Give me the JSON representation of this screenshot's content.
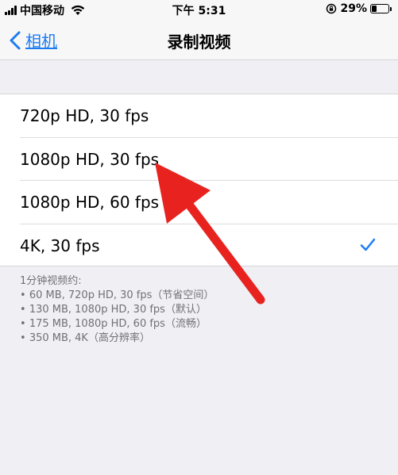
{
  "status_bar": {
    "carrier": "中国移动",
    "time": "下午 5:31",
    "battery_percent": "29%",
    "battery_level": 0.29
  },
  "nav": {
    "back_label": "相机",
    "title": "录制视频"
  },
  "options": [
    {
      "label": "720p HD, 30 fps",
      "selected": false
    },
    {
      "label": "1080p HD, 30 fps",
      "selected": false
    },
    {
      "label": "1080p HD, 60 fps",
      "selected": false
    },
    {
      "label": "4K, 30 fps",
      "selected": true
    }
  ],
  "footer": {
    "heading": "1分钟视频约:",
    "items": [
      "60 MB, 720p HD, 30 fps（节省空间）",
      "130 MB, 1080p HD, 30 fps（默认）",
      "175 MB, 1080p HD, 60 fps（流畅）",
      "350 MB, 4K（高分辨率）"
    ]
  },
  "colors": {
    "accent": "#1e7cf2",
    "annotation_arrow": "#e8231f",
    "background": "#efeff4"
  },
  "icons": {
    "back": "chevron-left-icon",
    "selected": "checkmark-icon",
    "wifi": "wifi-icon",
    "lock": "orientation-lock-icon",
    "battery": "battery-icon"
  }
}
